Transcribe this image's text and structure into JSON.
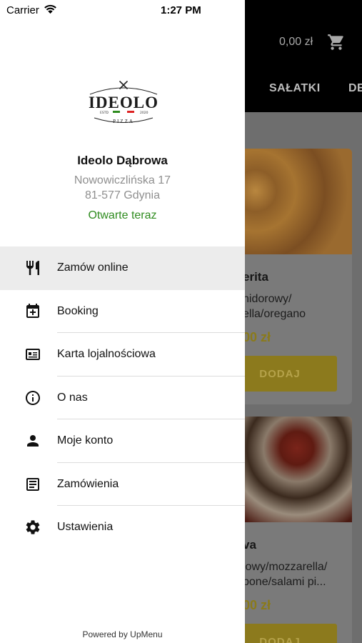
{
  "status_bar": {
    "carrier": "Carrier",
    "time": "1:27 PM"
  },
  "background": {
    "cart_total": "0,00 zł",
    "tabs": [
      "SAŁATKI",
      "DE"
    ],
    "cards": [
      {
        "title": "erita",
        "desc_lines": [
          "nidorowy/",
          "ella/oregano"
        ],
        "price": "00 zł",
        "button": "DODAJ"
      },
      {
        "title": "va",
        "desc_lines": [
          "lowy/mozzarella/",
          "pone/salami pi..."
        ],
        "price": "00 zł",
        "button": "DODAJ"
      }
    ]
  },
  "drawer": {
    "logo": {
      "name": "IDEOLO",
      "subtitle": "PIZZA",
      "estd": "ESTD",
      "year": "2020"
    },
    "restaurant_name": "Ideolo Dąbrowa",
    "address_line1": "Nowowiczlińska 17",
    "address_line2": "81-577 Gdynia",
    "open_status": "Otwarte teraz",
    "menu": [
      {
        "label": "Zamów online",
        "icon": "fork-knife-icon",
        "active": true
      },
      {
        "label": "Booking",
        "icon": "calendar-add-icon",
        "active": false
      },
      {
        "label": "Karta lojalnościowa",
        "icon": "loyalty-card-icon",
        "active": false
      },
      {
        "label": "O nas",
        "icon": "info-icon",
        "active": false
      },
      {
        "label": "Moje konto",
        "icon": "person-icon",
        "active": false
      },
      {
        "label": "Zamówienia",
        "icon": "receipt-icon",
        "active": false
      },
      {
        "label": "Ustawienia",
        "icon": "gear-icon",
        "active": false
      }
    ],
    "powered_by": "Powered by UpMenu"
  },
  "colors": {
    "open_status": "#2e8b1e",
    "active_item_bg": "#ececec",
    "overlay_header": "#000000"
  }
}
